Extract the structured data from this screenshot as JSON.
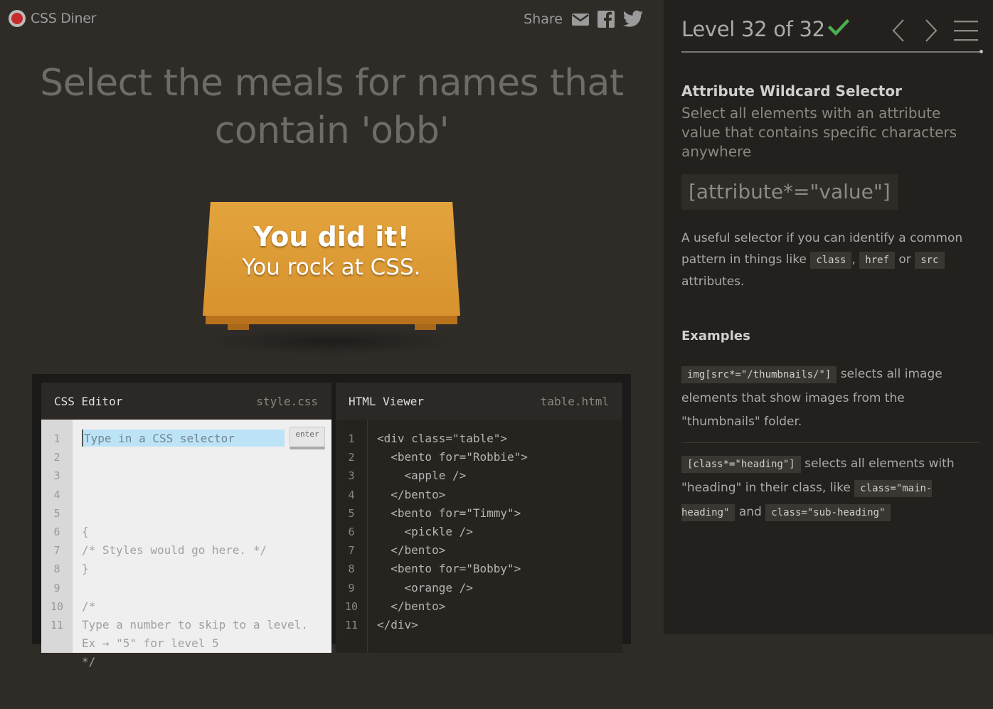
{
  "header": {
    "logo_text": "CSS Diner",
    "share_label": "Share",
    "share_icons": [
      "mail-icon",
      "facebook-icon",
      "twitter-icon"
    ]
  },
  "order": {
    "line1": "Select the meals for names that",
    "line2": "contain 'obb'"
  },
  "table": {
    "win_line1": "You did it!",
    "win_line2": "You rock at CSS."
  },
  "css_editor": {
    "title": "CSS Editor",
    "file": "style.css",
    "input_placeholder": "Type in a CSS selector",
    "enter_label": "enter",
    "line_numbers": [
      "1",
      "2",
      "3",
      "4",
      "5",
      "6",
      "7",
      "8",
      "9",
      "10",
      "11"
    ],
    "lines": [
      "",
      "{",
      "/* Styles would go here. */",
      "}",
      "",
      "/*",
      "Type a number to skip to a level.",
      "Ex → \"5\" for level 5",
      "*/",
      "",
      ""
    ]
  },
  "html_viewer": {
    "title": "HTML Viewer",
    "file": "table.html",
    "line_numbers": [
      "1",
      "2",
      "3",
      "4",
      "5",
      "6",
      "7",
      "8",
      "9",
      "10",
      "11"
    ],
    "lines": [
      "<div class=\"table\">",
      "  <bento for=\"Robbie\">",
      "    <apple />",
      "  </bento>",
      "  <bento for=\"Timmy\">",
      "    <pickle />",
      "  </bento>",
      "  <bento for=\"Bobby\">",
      "    <orange />",
      "  </bento>",
      "</div>"
    ]
  },
  "sidebar": {
    "level_text": "Level 32 of 32",
    "completed": true,
    "progress": 1.0,
    "selector_title": "Attribute Wildcard Selector",
    "selector_desc": "Select all elements with an attribute value that contains specific characters anywhere",
    "syntax": "[attribute*=\"value\"]",
    "hint_pre": "A useful selector if you can identify a common pattern in things like",
    "hint_tag1": "class",
    "hint_sep": ",",
    "hint_tag2": "href",
    "hint_or": "or",
    "hint_tag3": "src",
    "hint_post": "attributes.",
    "examples_title": "Examples",
    "example1_code": "img[src*=\"/thumbnails/\"]",
    "example1_text": "selects all image elements that show images from the \"thumbnails\" folder.",
    "example2_code": "[class*=\"heading\"]",
    "example2_text": "selects all elements with \"heading\" in their class, like",
    "example2_tag1": "class=\"main-heading\"",
    "example2_and": "and",
    "example2_tag2": "class=\"sub-heading\""
  },
  "colors": {
    "accent_check": "#4caf50",
    "table": "#dd9a33",
    "background": "#2f2c28",
    "sidebar": "#23201d"
  }
}
